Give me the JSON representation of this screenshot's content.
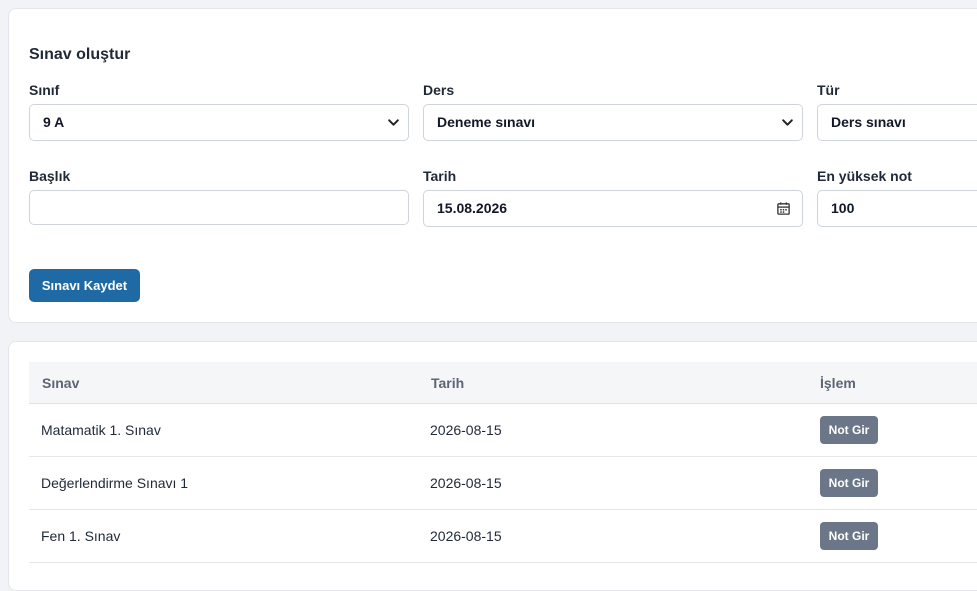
{
  "form": {
    "title": "Sınav oluştur",
    "class_label": "Sınıf",
    "class_value": "9 A",
    "course_label": "Ders",
    "course_value": "Deneme sınavı",
    "type_label": "Tür",
    "type_value": "Ders sınavı",
    "title_label": "Başlık",
    "title_value": "",
    "date_label": "Tarih",
    "date_value": "15.08.2026",
    "max_label": "En yüksek not",
    "max_value": "100",
    "save_label": "Sınavı Kaydet"
  },
  "table": {
    "headers": [
      "Sınav",
      "Tarih",
      "İşlem"
    ],
    "rows": [
      {
        "name": "Matamatik 1. Sınav",
        "date": "2026-08-15",
        "action": "Not Gir"
      },
      {
        "name": "Değerlendirme Sınavı 1",
        "date": "2026-08-15",
        "action": "Not Gir"
      },
      {
        "name": "Fen 1. Sınav",
        "date": "2026-08-15",
        "action": "Not Gir"
      }
    ]
  },
  "colors": {
    "primary": "#1f6aa5",
    "secondary_button": "#6b7789"
  },
  "icons": [
    "chevron-down-icon",
    "calendar-icon"
  ]
}
